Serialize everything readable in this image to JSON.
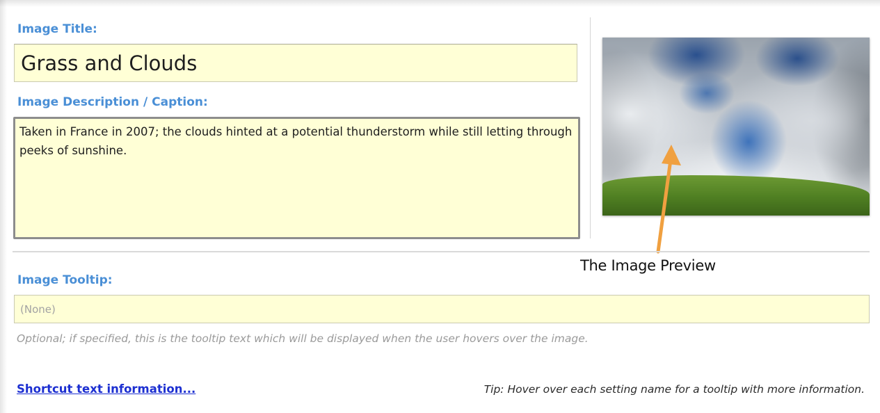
{
  "form": {
    "title_label": "Image Title:",
    "title_value": "Grass and Clouds",
    "description_label": "Image Description / Caption:",
    "description_value": "Taken in France in 2007; the clouds hinted at a potential thunderstorm while still letting through peeks of sunshine.",
    "tooltip_label": "Image Tooltip:",
    "tooltip_placeholder": "(None)",
    "tooltip_hint": "Optional; if specified, this is the tooltip text which will be displayed when the user hovers over the image."
  },
  "preview": {
    "annotation": "The Image Preview",
    "arrow_color": "#f0a040"
  },
  "footer": {
    "shortcut_link": "Shortcut text information...",
    "tip": "Tip: Hover over each setting name for a tooltip with more information."
  },
  "colors": {
    "label": "#4a8fd6",
    "field_background": "#ffffd6",
    "link": "#1c2fd1"
  },
  "icons": {
    "annotation_arrow": "arrow-up-icon"
  }
}
